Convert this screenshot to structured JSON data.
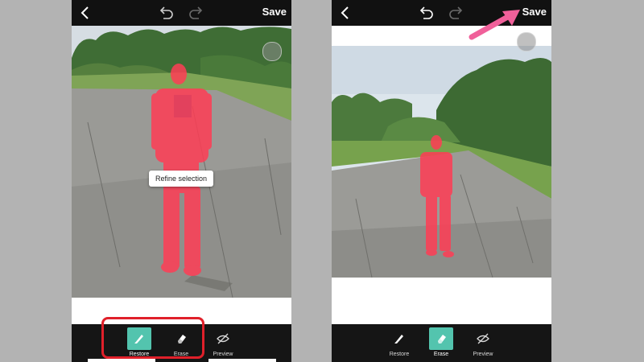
{
  "left": {
    "topbar": {
      "save_label": "Save"
    },
    "popup_text": "Refine selection",
    "tools": [
      {
        "label": "Restore",
        "icon": "brush-icon",
        "active": true
      },
      {
        "label": "Erase",
        "icon": "eraser-icon",
        "active": false
      },
      {
        "label": "Preview",
        "icon": "eye-slash-icon",
        "active": false
      }
    ]
  },
  "right": {
    "topbar": {
      "save_label": "Save"
    },
    "tools": [
      {
        "label": "Restore",
        "icon": "brush-icon",
        "active": false
      },
      {
        "label": "Erase",
        "icon": "eraser-icon",
        "active": true
      },
      {
        "label": "Preview",
        "icon": "eye-slash-icon",
        "active": false
      }
    ]
  },
  "colors": {
    "accent": "#53c4ae",
    "selection_overlay": "#ff3d55",
    "annotation_red": "#e0202a",
    "annotation_pink": "#f0609a"
  }
}
